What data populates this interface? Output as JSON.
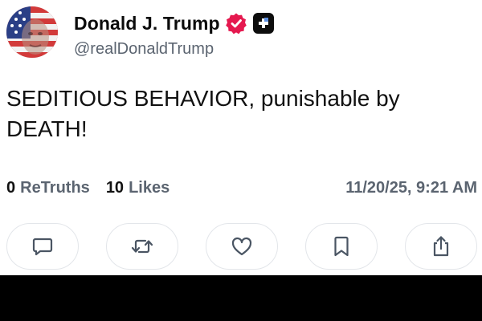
{
  "author": {
    "display_name": "Donald J. Trump",
    "handle": "@realDonaldTrump",
    "verified_icon": "verified-badge-icon",
    "badge_icon": "plus-badge-icon",
    "avatar": "profile-avatar"
  },
  "post": {
    "text": "SEDITIOUS BEHAVIOR, punishable by DEATH!"
  },
  "stats": {
    "retruths_count": "0",
    "retruths_label": "ReTruths",
    "likes_count": "10",
    "likes_label": "Likes",
    "timestamp": "11/20/25, 9:21 AM"
  },
  "actions": [
    {
      "name": "reply",
      "icon": "comment-icon"
    },
    {
      "name": "retruth",
      "icon": "retruth-icon"
    },
    {
      "name": "like",
      "icon": "heart-icon"
    },
    {
      "name": "bookmark",
      "icon": "bookmark-icon"
    },
    {
      "name": "share",
      "icon": "share-icon"
    }
  ],
  "colors": {
    "verified": "#e5194f",
    "secondary_text": "#5b6470",
    "icon_stroke": "#4a5563",
    "button_border": "#e3e6ea",
    "bottom_bar": "#000000"
  }
}
